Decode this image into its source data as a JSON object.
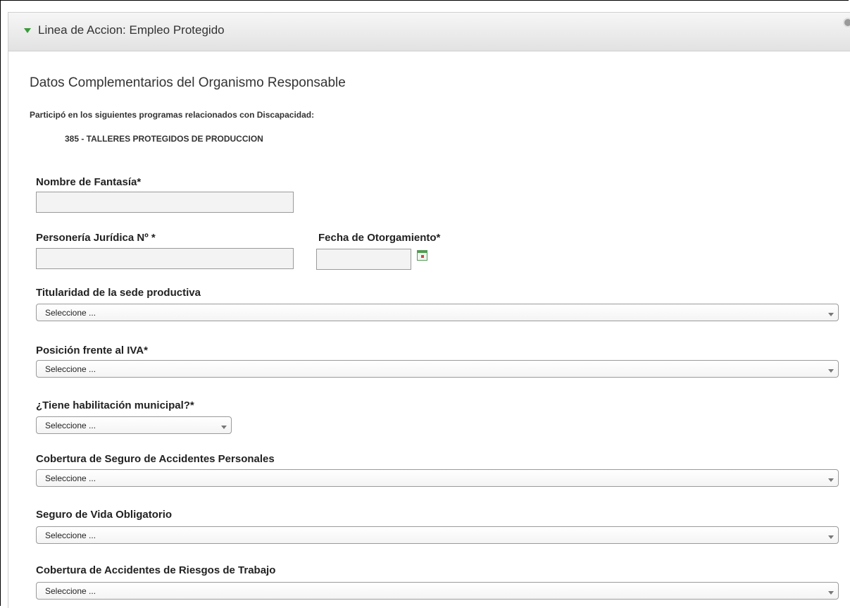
{
  "panel": {
    "title": "Linea de Accion: Empleo Protegido"
  },
  "section": {
    "title": "Datos Complementarios del Organismo Responsable",
    "programs_note": "Participó en los siguientes programas relacionados con Discapacidad:",
    "programs": [
      "385 - TALLERES PROTEGIDOS DE PRODUCCION"
    ]
  },
  "form": {
    "nombre_fantasia": {
      "label": "Nombre de Fantasía*",
      "value": ""
    },
    "personeria": {
      "label": "Personería Jurídica Nº *",
      "value": ""
    },
    "fecha_otorgamiento": {
      "label": "Fecha de Otorgamiento*",
      "value": ""
    },
    "titularidad": {
      "label": "Titularidad de la sede productiva",
      "selected": "Seleccione ..."
    },
    "posicion_iva": {
      "label": "Posición frente al IVA*",
      "selected": "Seleccione ..."
    },
    "habilitacion": {
      "label": "¿Tiene habilitación municipal?*",
      "selected": "Seleccione ..."
    },
    "seguro_accidentes": {
      "label": "Cobertura de Seguro de Accidentes Personales",
      "selected": "Seleccione ..."
    },
    "seguro_vida": {
      "label": "Seguro de Vida Obligatorio",
      "selected": "Seleccione ..."
    },
    "riesgos_trabajo": {
      "label": "Cobertura de Accidentes de Riesgos de Trabajo",
      "selected": "Seleccione ..."
    }
  },
  "icons": {
    "collapse": "triangle-down-icon",
    "calendar": "calendar-icon",
    "dropdown": "chevron-down-icon"
  },
  "colors": {
    "accent_green": "#3a9a3a",
    "header_bg": "#e6e6e6"
  }
}
